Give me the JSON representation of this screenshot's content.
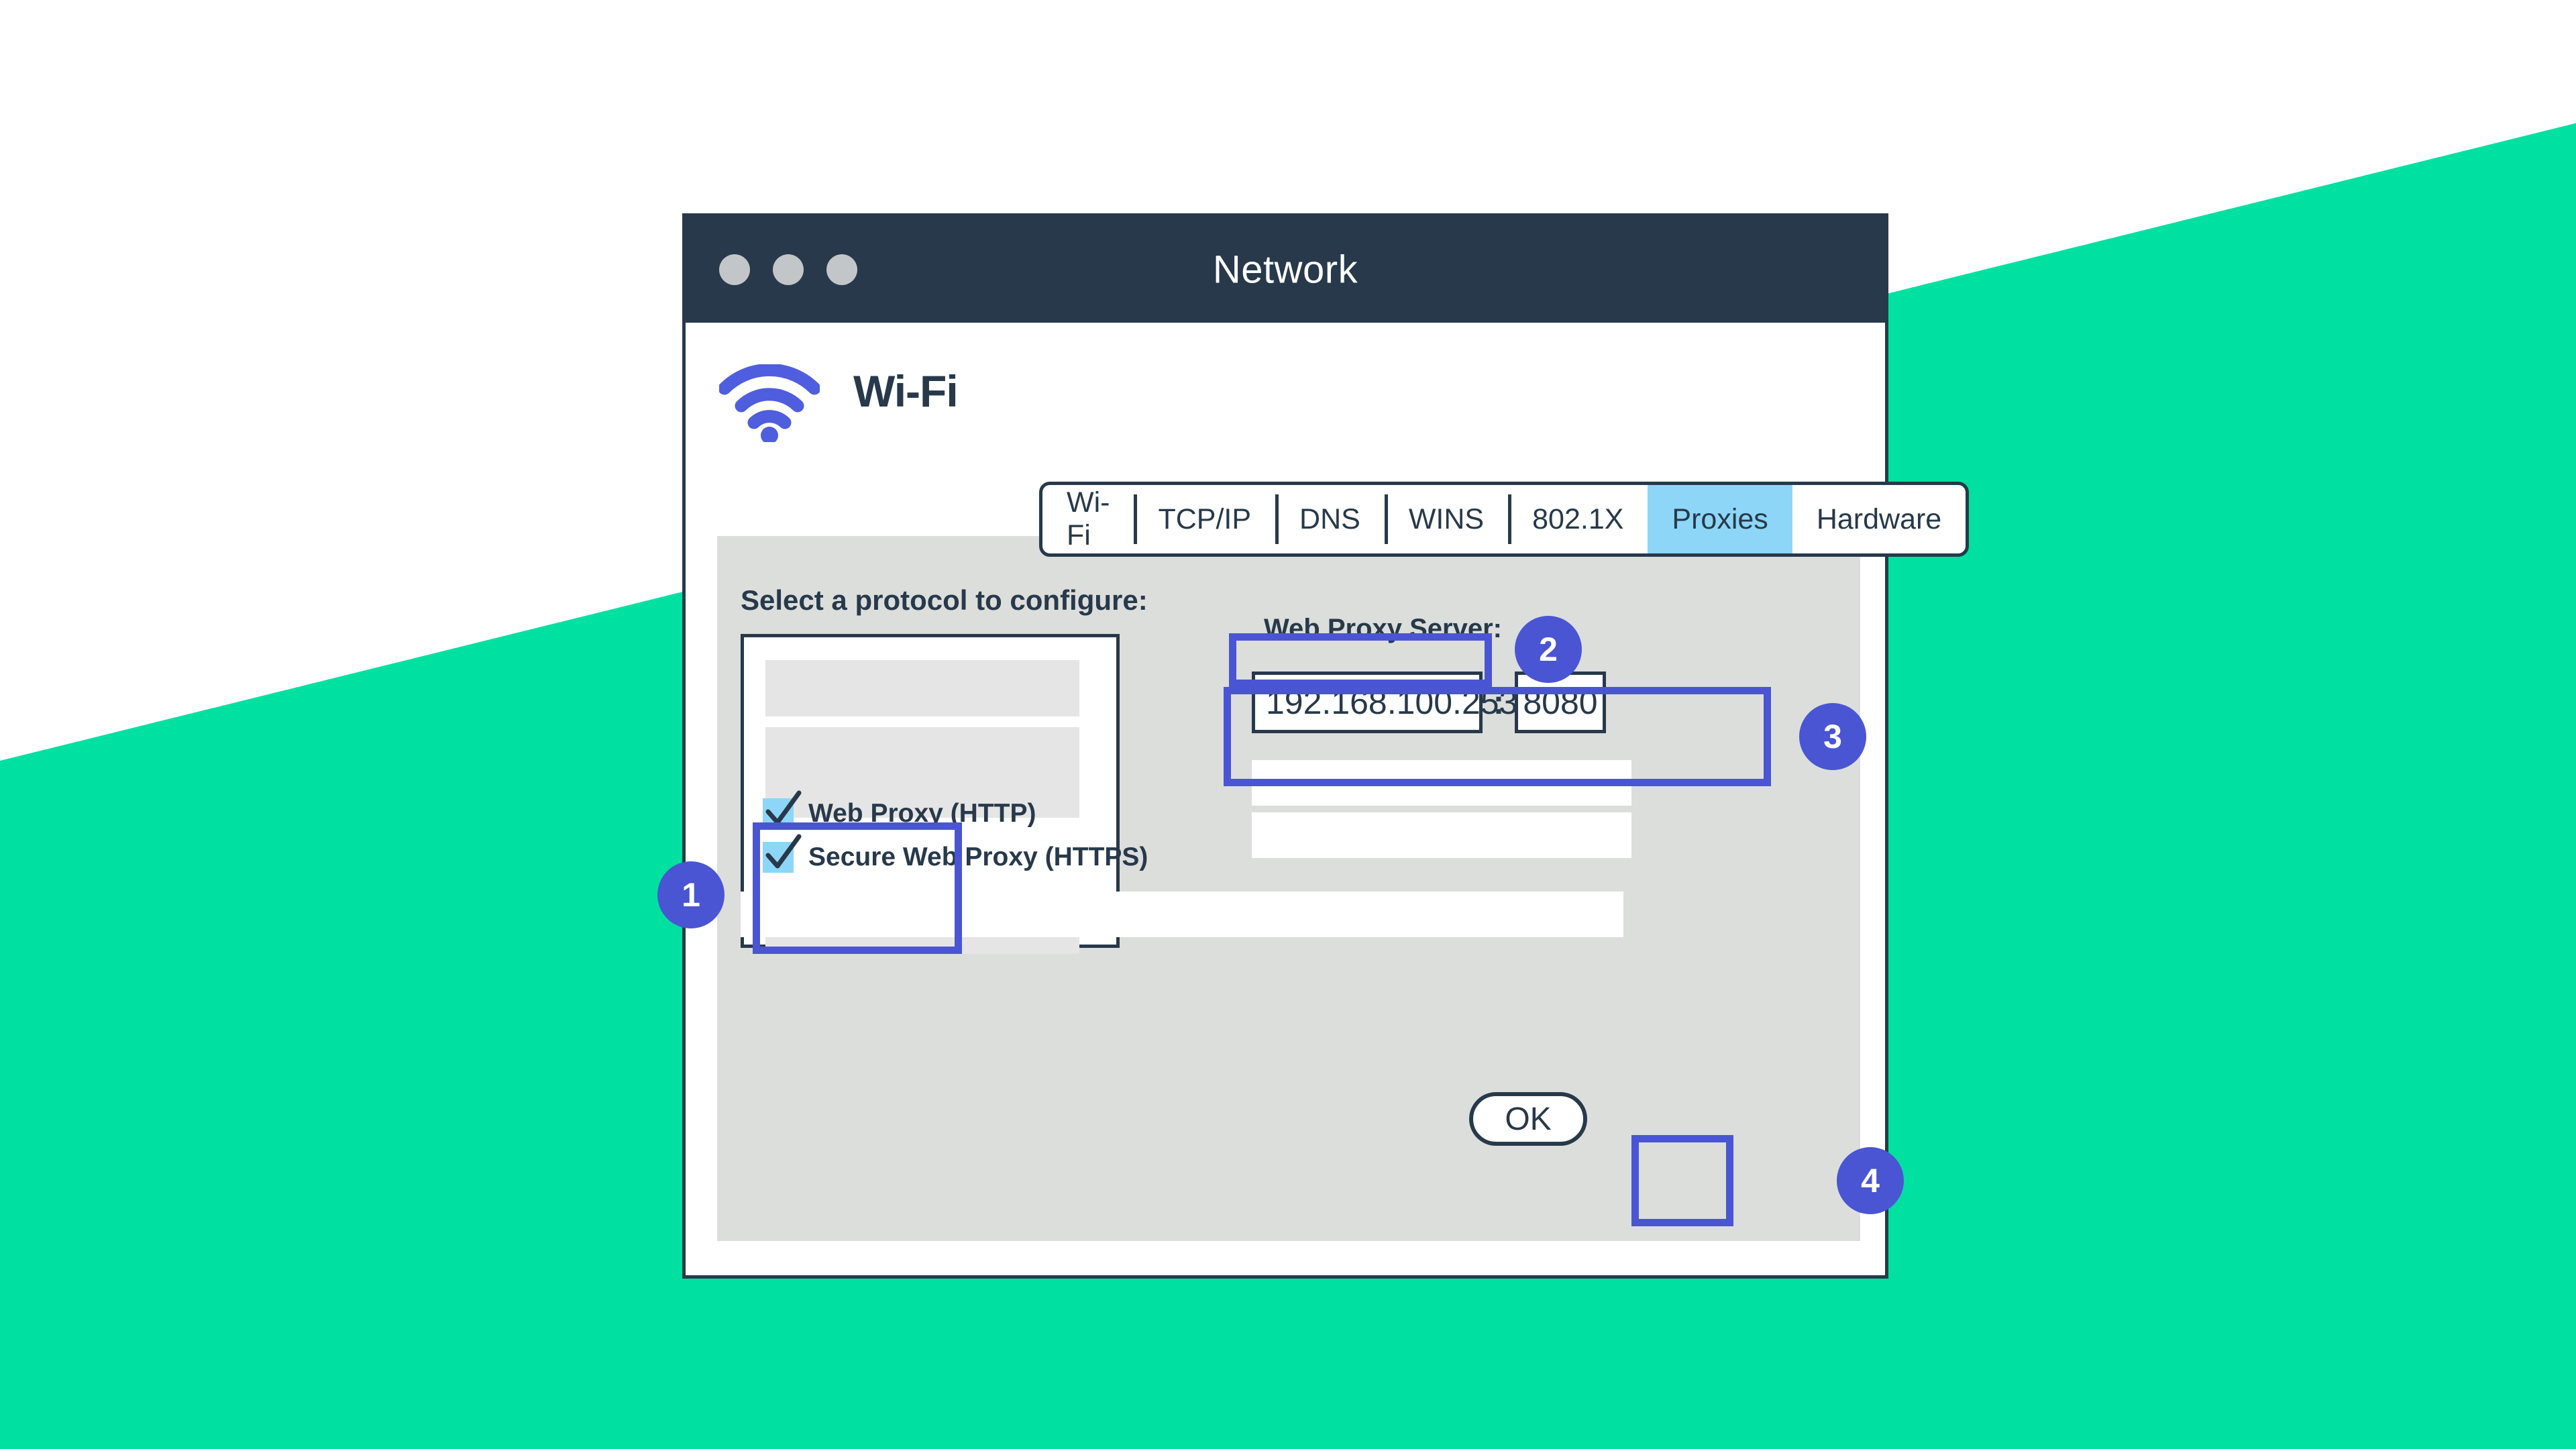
{
  "background": {
    "teal": "#00e0a1",
    "white": "#ffffff"
  },
  "theme": {
    "dark": "#27394a",
    "accent_blue": "#4a55d4",
    "tab_active": "#8ed6f7",
    "panel_gray": "#dcdedc",
    "placeholder_gray": "#e5e5e5"
  },
  "window": {
    "title": "Network",
    "traffic_lights": [
      "close-dot",
      "minimize-dot",
      "maximize-dot"
    ]
  },
  "header": {
    "icon": "wifi-icon",
    "label": "Wi-Fi"
  },
  "tabs": [
    {
      "label": "Wi-Fi",
      "active": false
    },
    {
      "label": "TCP/IP",
      "active": false
    },
    {
      "label": "DNS",
      "active": false
    },
    {
      "label": "WINS",
      "active": false
    },
    {
      "label": "802.1X",
      "active": false
    },
    {
      "label": "Proxies",
      "active": true
    },
    {
      "label": "Hardware",
      "active": false
    }
  ],
  "protocol_section": {
    "label": "Select a protocol to configure:",
    "checkboxes": [
      {
        "label": "Web Proxy  (HTTP)",
        "checked": true
      },
      {
        "label": "Secure Web Proxy  (HTTPS)",
        "checked": true
      }
    ]
  },
  "proxy_server": {
    "label": "Web Proxy Server:",
    "host": "192.168.100.253",
    "separator": ":",
    "port": "8080"
  },
  "buttons": {
    "ok": "OK"
  },
  "badges": [
    {
      "number": "1"
    },
    {
      "number": "2"
    },
    {
      "number": "3"
    },
    {
      "number": "4"
    }
  ]
}
